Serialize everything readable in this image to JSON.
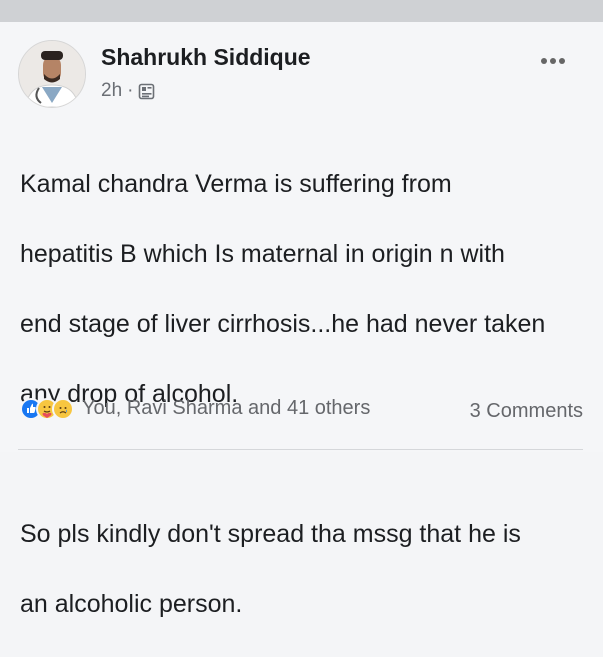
{
  "post": {
    "author": "Shahrukh Siddique",
    "time": "2h",
    "separator": "·",
    "body_lines": [
      "Kamal chandra Verma is suffering from",
      "hepatitis B which Is maternal in origin n with",
      "end stage of liver cirrhosis...he had never taken",
      "any drop of alcohol.",
      "",
      "So pls kindly don't spread tha mssg that he is",
      "an alcoholic person."
    ],
    "reactions_text": "You, Ravi Sharma and 41 others",
    "comments_text": "3 Comments",
    "reaction_icons": [
      "like-icon",
      "care-icon",
      "sad-icon"
    ]
  },
  "colors": {
    "top_bar": "#cfd1d4",
    "like_blue": "#1877f2",
    "emoji_yellow": "#f7c640"
  }
}
